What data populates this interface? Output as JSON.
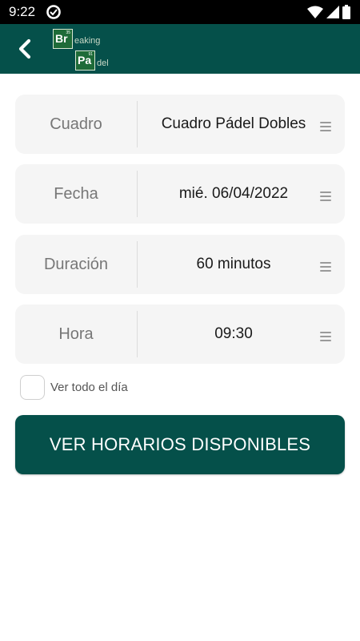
{
  "status_bar": {
    "time": "9:22",
    "icons": [
      "sync-icon",
      "wifi-icon",
      "signal-icon",
      "battery-icon"
    ]
  },
  "app_bar": {
    "back_icon": "chevron-left-icon",
    "logo": {
      "block1": "Br",
      "block1_sup": "35",
      "tail1": "eaking",
      "block2": "Pa",
      "block2_sup": "91",
      "tail2": "del"
    }
  },
  "form": {
    "fields": [
      {
        "label": "Cuadro",
        "value": "Cuadro Pádel Dobles"
      },
      {
        "label": "Fecha",
        "value": "mié. 06/04/2022"
      },
      {
        "label": "Duración",
        "value": "60 minutos"
      },
      {
        "label": "Hora",
        "value": "09:30"
      }
    ],
    "checkbox": {
      "label": "Ver todo el día",
      "checked": false
    },
    "submit_label": "VER HORARIOS DISPONIBLES"
  },
  "colors": {
    "primary": "#05504a",
    "field_bg": "#f5f5f5",
    "logo_green": "#1e6b38"
  }
}
